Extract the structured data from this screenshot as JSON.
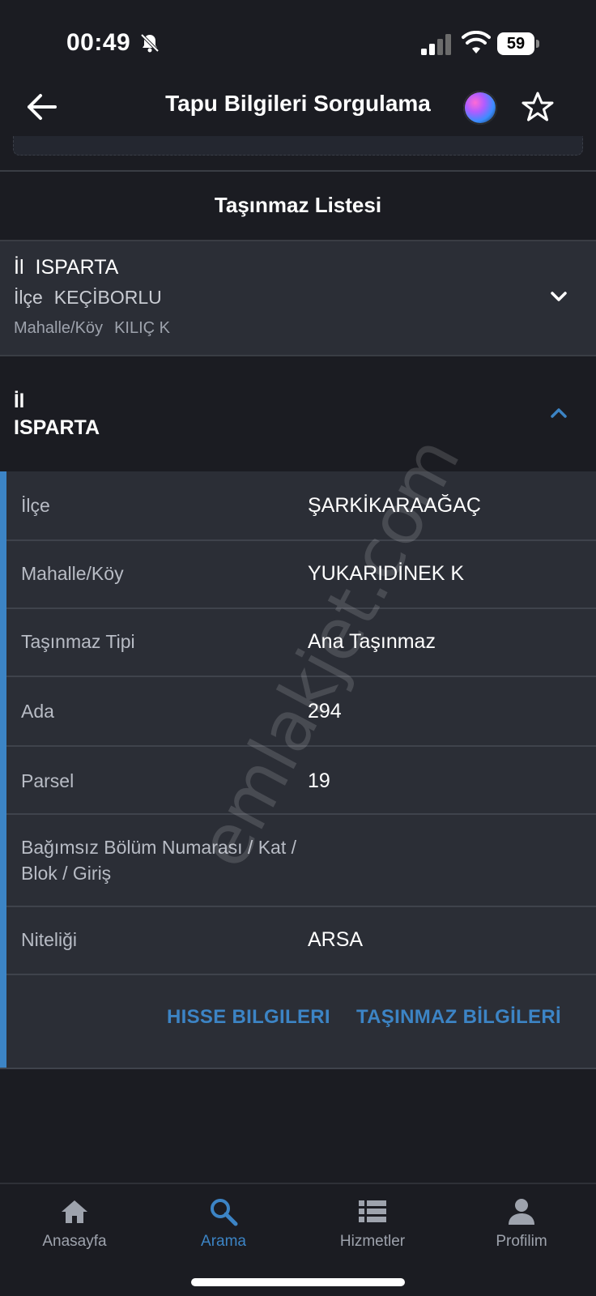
{
  "status_bar": {
    "time": "00:49",
    "battery": "59",
    "icons": [
      "bell-slash-icon",
      "cellular-signal-icon",
      "wifi-icon",
      "battery-icon"
    ]
  },
  "nav": {
    "title": "Tapu Bilgileri Sorgulama",
    "back_icon": "arrow-left-icon",
    "assistant_icon": "siri-icon",
    "favorite_icon": "star-outline-icon"
  },
  "section": {
    "title": "Taşınmaz Listesi"
  },
  "collapsed_card": {
    "il_label": "İl",
    "il_value": "ISPARTA",
    "ilce_label": "İlçe",
    "ilce_value": "KEÇİBORLU",
    "mahalle_label": "Mahalle/Köy",
    "mahalle_value": "KILIÇ K",
    "toggle_icon": "chevron-down-icon"
  },
  "expanded_card": {
    "il_label": "İl",
    "il_value": "ISPARTA",
    "toggle_icon": "chevron-up-icon",
    "rows": [
      {
        "label": "İlçe",
        "value": "ŞARKİKARAAĞAÇ"
      },
      {
        "label": "Mahalle/Köy",
        "value": "YUKARIDİNEK K"
      },
      {
        "label": "Taşınmaz Tipi",
        "value": "Ana Taşınmaz"
      },
      {
        "label": "Ada",
        "value": "294"
      },
      {
        "label": "Parsel",
        "value": "19"
      },
      {
        "label": "Bağımsız Bölüm Numarası / Kat / Blok / Giriş",
        "value": ""
      },
      {
        "label": "Niteliği",
        "value": "ARSA"
      }
    ],
    "actions": {
      "hisse": "HISSE BILGILERI",
      "tasinmaz": "TAŞINMAZ BİLGİLERİ"
    }
  },
  "watermark": "emlakjet.com",
  "tab_bar": {
    "tabs": [
      {
        "label": "Anasayfa",
        "icon": "home-icon",
        "active": false
      },
      {
        "label": "Arama",
        "icon": "search-icon",
        "active": true
      },
      {
        "label": "Hizmetler",
        "icon": "list-icon",
        "active": false
      },
      {
        "label": "Profilim",
        "icon": "person-icon",
        "active": false
      }
    ]
  },
  "colors": {
    "background": "#1b1c22",
    "card": "#2b2e36",
    "accent": "#3c84c5",
    "muted_text": "#b8bcc5"
  }
}
